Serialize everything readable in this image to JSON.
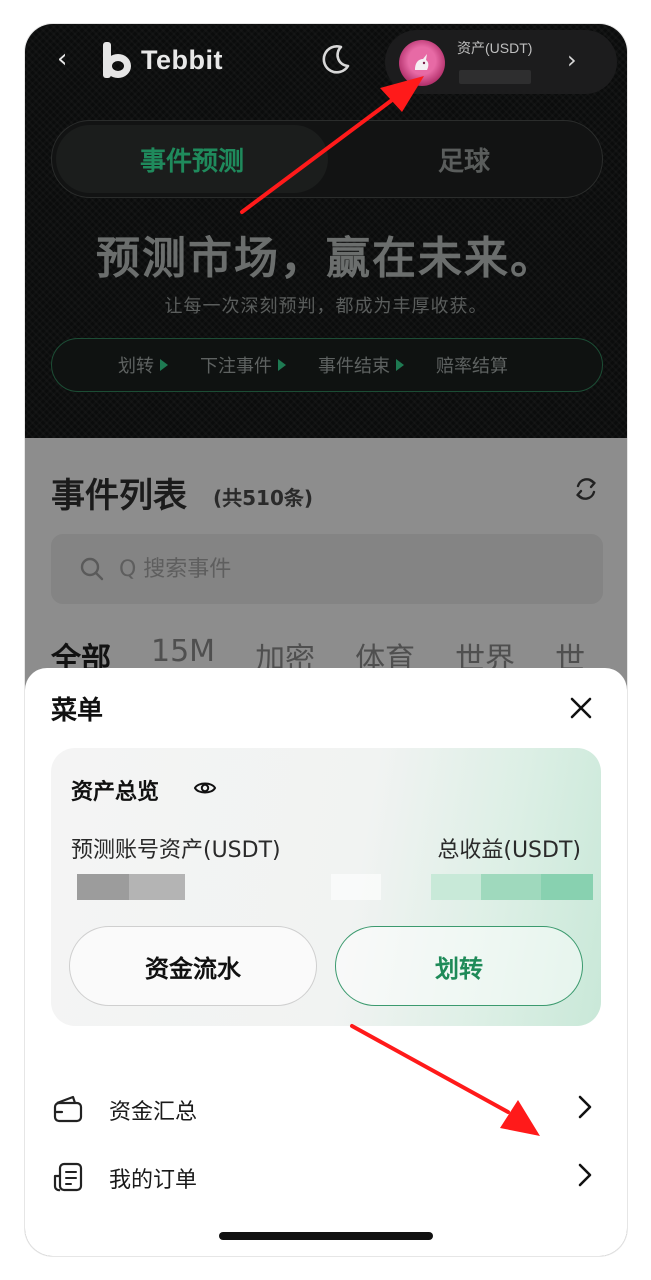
{
  "header": {
    "logo_text": "Tebbit",
    "asset_label": "资产(USDT)"
  },
  "segment": {
    "tabs": [
      "事件预测",
      "足球"
    ],
    "active": "事件预测"
  },
  "hero": {
    "slogan": "预测市场，赢在未来。",
    "subslogan": "让每一次深刻预判，都成为丰厚收获。",
    "steps": [
      "划转",
      "下注事件",
      "事件结束",
      "赔率结算"
    ]
  },
  "event_list": {
    "title": "事件列表",
    "count_text": "(共510条)",
    "search_placeholder": "Q 搜索事件",
    "categories": [
      "全部",
      "15M",
      "加密",
      "体育",
      "世界",
      "世"
    ]
  },
  "menu": {
    "title": "菜单",
    "overview_title": "资产总览",
    "account_assets_label": "预测账号资产(USDT)",
    "total_profit_label": "总收益(USDT)",
    "flow_button": "资金流水",
    "transfer_button": "划转",
    "items": [
      {
        "label": "资金汇总",
        "icon": "wallet-icon"
      },
      {
        "label": "我的订单",
        "icon": "receipt-icon"
      }
    ]
  },
  "colors": {
    "accent_green": "#1e8a58",
    "annotation_red": "#ff1a1a",
    "hero_bg": "#0b0c0c"
  }
}
